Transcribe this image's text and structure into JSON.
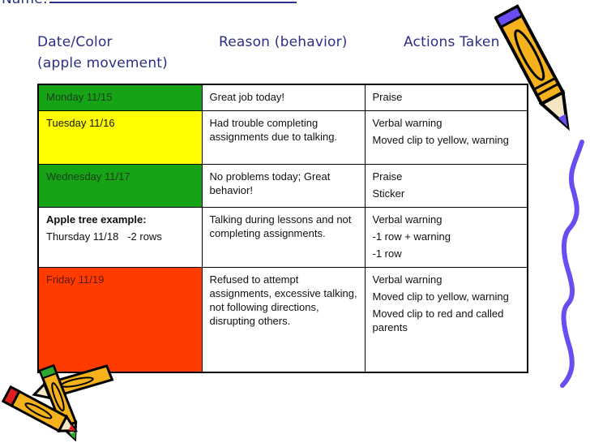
{
  "header": {
    "name_label": "Name:",
    "col_date": "Date/Color",
    "col_date_sub": "(apple movement)",
    "col_reason": "Reason (behavior)",
    "col_actions": "Actions Taken"
  },
  "colors": {
    "green": "#16a316",
    "yellow": "#ffff00",
    "red": "#ff3b00",
    "heading_ink": "#2b2f86",
    "pencil_yellow": "#f5b21c",
    "scribble_purple": "#6a4cf0"
  },
  "rows": [
    {
      "date": "Monday 11/15",
      "color": "green",
      "reason": "Great job today!",
      "actions": [
        "Praise"
      ]
    },
    {
      "date": "Tuesday 11/16",
      "color": "yellow",
      "reason": "Had trouble completing assignments due to talking.",
      "actions": [
        "Verbal warning",
        "Moved clip to yellow, warning"
      ]
    },
    {
      "date": "Wednesday 11/17",
      "color": "green",
      "reason": "No problems today; Great behavior!",
      "actions": [
        "Praise",
        "Sticker"
      ]
    },
    {
      "label": "Apple tree example:",
      "date": "Thursday 11/18   -2 rows",
      "color": "white",
      "reason": "Talking during lessons and not completing assignments.",
      "actions": [
        "Verbal warning",
        "-1 row + warning",
        "-1 row"
      ]
    },
    {
      "date": "Friday 11/19",
      "color": "red",
      "reason": "Refused to attempt assignments, excessive talking, not following directions, disrupting others.",
      "actions": [
        "Verbal warning",
        "Moved clip to yellow, warning",
        "Moved clip to red and called parents"
      ]
    }
  ],
  "decorations": [
    "pencil-icon",
    "scribble",
    "crossed-pencils-icon"
  ]
}
